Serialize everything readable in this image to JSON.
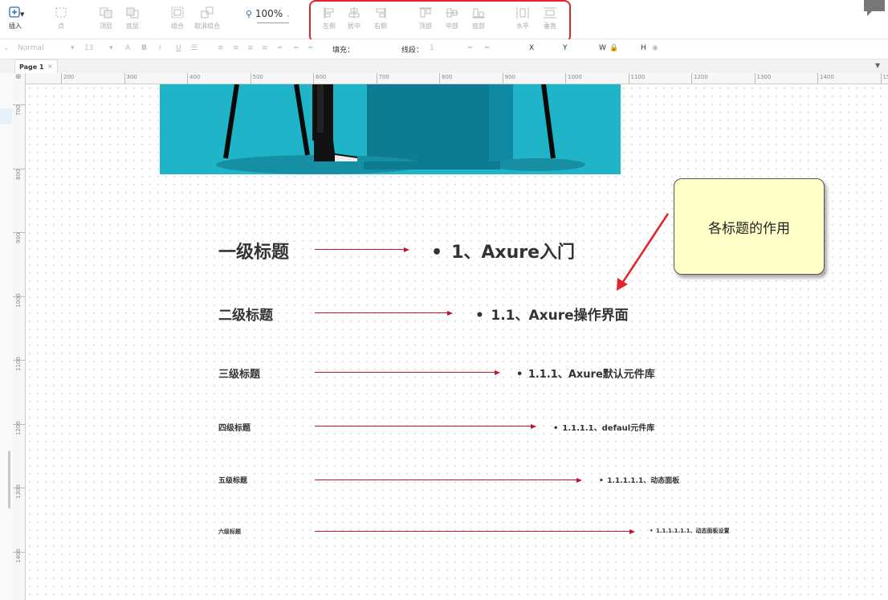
{
  "toolbar": {
    "insert_label": "插入",
    "point_label": "点",
    "top_layer_label": "顶层",
    "bottom_layer_label": "底层",
    "group_label": "组合",
    "ungroup_label": "取消组合",
    "zoom_value": "100%",
    "align": {
      "left_label": "左侧",
      "center_label": "居中",
      "right_label": "右侧",
      "top_label": "顶部",
      "middle_label": "中部",
      "bottom_label": "底部",
      "horizontal_label": "水平",
      "vertical_label": "垂直"
    }
  },
  "formatbar": {
    "font_style": "Normal",
    "font_size": "13",
    "fill_label": "填充：",
    "line_label": "线段：",
    "line_value": "1",
    "x_label": "X",
    "y_label": "Y",
    "w_label": "W",
    "h_label": "H"
  },
  "tabs": [
    {
      "label": "Page 1",
      "close": "×"
    }
  ],
  "ruler": {
    "h_ticks": [
      "200",
      "300",
      "400",
      "500",
      "600",
      "700",
      "800",
      "900",
      "1000",
      "1100",
      "1200",
      "1300",
      "1400",
      "1500"
    ],
    "v_ticks": [
      "700",
      "800",
      "900",
      "1000",
      "1100",
      "1200",
      "1300",
      "1400"
    ]
  },
  "headings": [
    {
      "label": "一级标题",
      "text": "1、Axure入门"
    },
    {
      "label": "二级标题",
      "text": "1.1、Axure操作界面"
    },
    {
      "label": "三级标题",
      "text": "1.1.1、Axure默认元件库"
    },
    {
      "label": "四级标题",
      "text": "1.1.1.1、defaul元件库"
    },
    {
      "label": "五级标题",
      "text": "1.1.1.1.1、动态面板"
    },
    {
      "label": "六级标题",
      "text": "1.1.1.1.1.1、动态面板设置"
    }
  ],
  "note": {
    "text": "各标题的作用"
  },
  "colors": {
    "arrow": "#c0142e",
    "highlight": "#e0262c",
    "note_bg": "#ffffc8",
    "hero_bg": "#1fb4c8"
  },
  "icons": [
    "plus-icon",
    "chevron-down-icon",
    "align-left-icon",
    "align-center-icon",
    "align-right-icon",
    "align-top-icon",
    "align-middle-icon",
    "align-bottom-icon",
    "distribute-horizontal-icon",
    "distribute-vertical-icon",
    "search-icon",
    "chat-icon"
  ]
}
